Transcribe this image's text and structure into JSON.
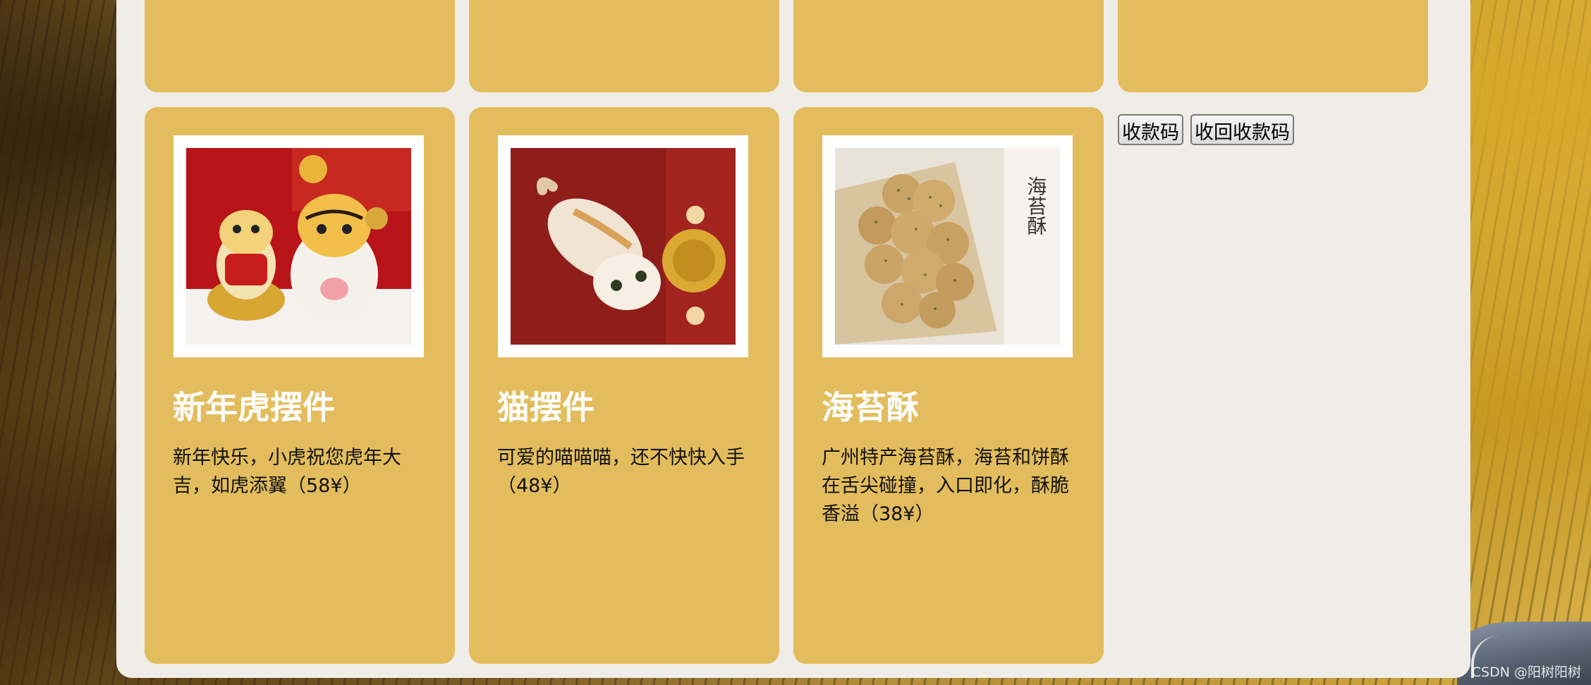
{
  "products": [
    {
      "title": "新年虎摆件",
      "description": "新年快乐，小虎祝您虎年大吉，如虎添翼（58¥）",
      "image": "tiger-figurines"
    },
    {
      "title": "猫摆件",
      "description": "可爱的喵喵喵，还不快快入手（48¥）",
      "image": "cat-figurine"
    },
    {
      "title": "海苔酥",
      "description": "广州特产海苔酥，海苔和饼酥在舌尖碰撞，入口即化，酥脆香溢（38¥）",
      "image": "seaweed-cookies",
      "package_text": "海苔酥"
    }
  ],
  "buttons": {
    "payment_code": "收款码",
    "hide_payment_code": "收回收款码"
  },
  "watermark": "CSDN @阳树阳树",
  "colors": {
    "card": "#e3bd5d",
    "panel": "#f0ede9"
  }
}
